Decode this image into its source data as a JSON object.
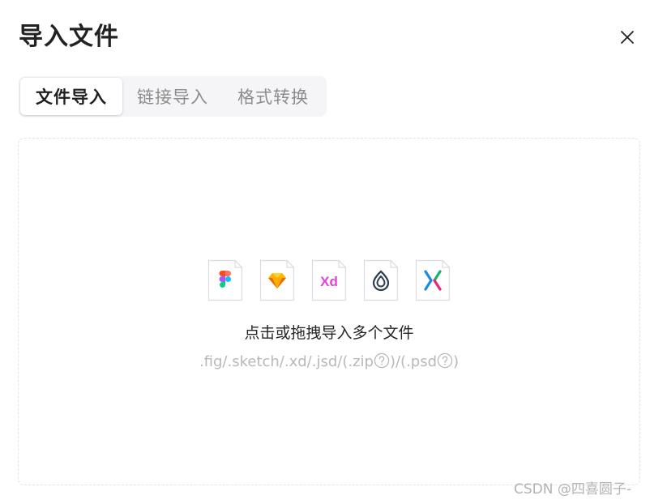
{
  "dialog": {
    "title": "导入文件",
    "close_icon": "close-icon"
  },
  "tabs": [
    {
      "label": "文件导入",
      "active": true
    },
    {
      "label": "链接导入",
      "active": false
    },
    {
      "label": "格式转换",
      "active": false
    }
  ],
  "dropzone": {
    "file_types": [
      {
        "name": "figma",
        "icon": "figma-icon",
        "colors": [
          "#f24e1e",
          "#ff7262",
          "#a259ff",
          "#1abcfe",
          "#0acf83"
        ]
      },
      {
        "name": "sketch",
        "icon": "sketch-icon",
        "colors": [
          "#fdb300",
          "#ea6c00"
        ]
      },
      {
        "name": "xd",
        "icon": "xd-icon",
        "text": "Xd",
        "colors": [
          "#e83fd8"
        ]
      },
      {
        "name": "jsd",
        "icon": "jsdesign-icon",
        "colors": [
          "#2c3e50"
        ]
      },
      {
        "name": "axure",
        "icon": "axure-icon",
        "colors": [
          "#1a8ce0",
          "#13b46a",
          "#e8277a"
        ]
      }
    ],
    "hint": "点击或拖拽导入多个文件",
    "formats": {
      "part1": ".fig/.sketch/.xd/.jsd/(.zip",
      "part2": ")/(.psd",
      "part3": ")"
    },
    "help_icon": "help-circle-icon"
  },
  "watermark": "CSDN @四喜圆子-"
}
